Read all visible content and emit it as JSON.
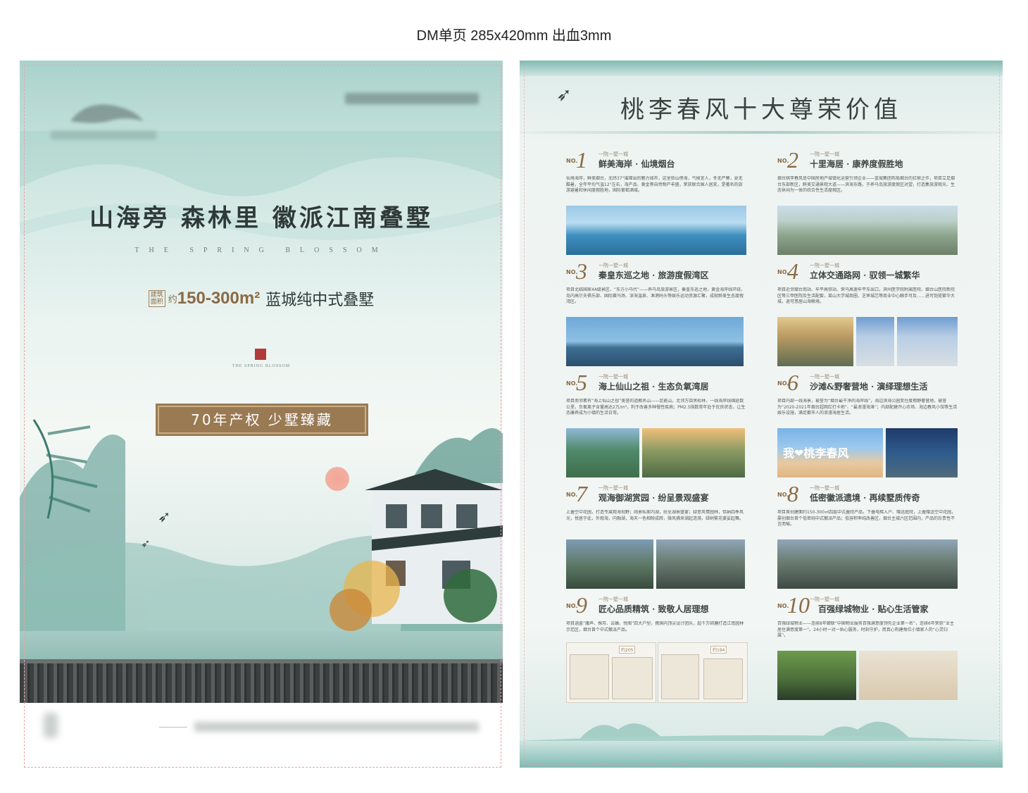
{
  "caption": "DM单页 285x420mm 出血3mm",
  "left_page": {
    "main_title": "山海旁 森林里 徽派江南叠墅",
    "en_title": "THE SPRING BLOSSOM",
    "area_badge": "建筑面积",
    "area_prefix": "约",
    "area_range": "150-300m²",
    "area_desc": "蓝城纯中式叠墅",
    "seal_text": "THE SPRING BLOSSOM",
    "slogan": "70年产权 少墅臻藏"
  },
  "right_page": {
    "title": "桃李春风十大尊荣价值",
    "items": [
      {
        "no": "NO.",
        "num": "1",
        "tag": "一院一墅一城",
        "title": "鲜美海岸 · 仙境烟台",
        "desc": "仙境海岸，鲜美烟台，北纬37°璀璨出的魅力城市，这里依山傍海，气候宜人，冬无严寒，夏无酷暑，全年平均气温12°左右，海产品、黄金等自然物产丰盛，荣获联合国人居奖，是著名的旅游避暑和休闲度假胜地，国际葡萄酒城。"
      },
      {
        "no": "NO.",
        "num": "2",
        "tag": "一院一墅一城",
        "title": "十里海居 · 康养度假胜地",
        "desc": "烟台桃李春风是中国房地产城镇化运营引领企业——蓝城集团布局烟台的扛鼎之作，项目立足烟台东部新区，醉美交通景观大道——滨海东路，于养马岛旅游度假区对望，打造集旅游观光、生态休闲为一体的综合性生活度假区。"
      },
      {
        "no": "NO.",
        "num": "3",
        "tag": "一院一墅一城",
        "title": "秦皇东巡之地 · 旅游度假湾区",
        "desc": "项目北临国家4A级景区、“东方小马代”——养马岛旅游景区，秦皇东巡之地，黄金海岸线环绕，岛内高尔夫俱乐部、国际赛马场、深海温泉、渔港码头等娱乐运动资源汇聚，成就醉美生态度假湾区。"
      },
      {
        "no": "NO.",
        "num": "4",
        "tag": "一院一墅一城",
        "title": "立体交通路网 · 驭领一城繁华",
        "desc": "项目近邻烟台南站、牟平高铁站、荣乌高速牟平东出口，滨州医学院附属医院、烟台山医院新院区等三甲医院及生活配套，莱山大学城商圈、芝罘城芯等商业中心触手可及……进可饱揽繁华大城，退可悠居山海鲸境。"
      },
      {
        "no": "NO.",
        "num": "5",
        "tag": "一院一墅一城",
        "title": "海上仙山之祖 · 生态负氧湾居",
        "desc": "项目南邻素有“海上仙山之祖”美誉的道教名山——昆嵛山，北邻万亩黑松林，一线海岸线绵延数公里，负氧离子含量高达2万/m³，利于改善多种慢性疾病；PM2.5指数常年处于优良状态，让生态康养成为小镇的生活日常。"
      },
      {
        "no": "NO.",
        "num": "6",
        "tag": "一院一墅一城",
        "title": "沙滩&野奢营地 · 演绎理想生活",
        "desc": "项目内部一线海景，被誉为“烟台最干净的海岸线”，海边滨海公园变住度假野奢营地，被誉为“2020-2021年烟台超网红打卡地”、“最浪漫海滩”；内部配建开心农场、海边春风小馆等生活娱乐设施，满足都市人的浪漫海居生活。",
        "photo_text": "我❤桃李春风"
      },
      {
        "no": "NO.",
        "num": "7",
        "tag": "一院一墅一城",
        "title": "观海御湖赏园 · 纷呈景观盛宴",
        "desc": "上叠空中花园，打造专属观海视野；阔景私家内湖，纷呈湖景盛宴；绿意风情园林，恬纳四季风光，悦居于此，外观海，内融湖，海天一色相映成辉，微风拂来湖起涟漪，绿树繁花婆娑起舞。"
      },
      {
        "no": "NO.",
        "num": "8",
        "tag": "一院一墅一城",
        "title": "低密徽派遗境 · 再续墅质传奇",
        "desc": "项目首创建面约150-300㎡四层中式叠院产品，下叠电梯入户、赠送庭院，上叠赠送空中花园，屡创烟台首个低密纯中式徽派产品；低容积率纯改善区，烟台主城六区范围内，产品的珍贵性不言而喻。"
      },
      {
        "no": "NO.",
        "num": "9",
        "tag": "一院一墅一城",
        "title": "匠心品质精筑 · 致敬人居理想",
        "desc": "项目涵盖“腹声、掬月、云蛐、悦阁”四大户型，携国内顶尖设计团队，超千万研磨打造江南园林示范区，烟台首个中式徽派产品。",
        "plan_tags": [
          "约205",
          "约194"
        ]
      },
      {
        "no": "NO.",
        "num": "10",
        "tag": "一院一墅一城",
        "title": "百强绿城物业 · 贴心生活管家",
        "desc": "百强绿城物业——连续8年蝉联“中国物业服务百强满意度领先企业第一名”，连续6年荣获“业主居住满意度第一”。24小时一对一贴心服务，时刻守护，用真心构建每位小镇家人的“心灵归属”。"
      }
    ]
  },
  "colors": {
    "accent_gold": "#8a6a45",
    "teal": "#7fbbb3",
    "seal_red": "#b23a3a"
  }
}
